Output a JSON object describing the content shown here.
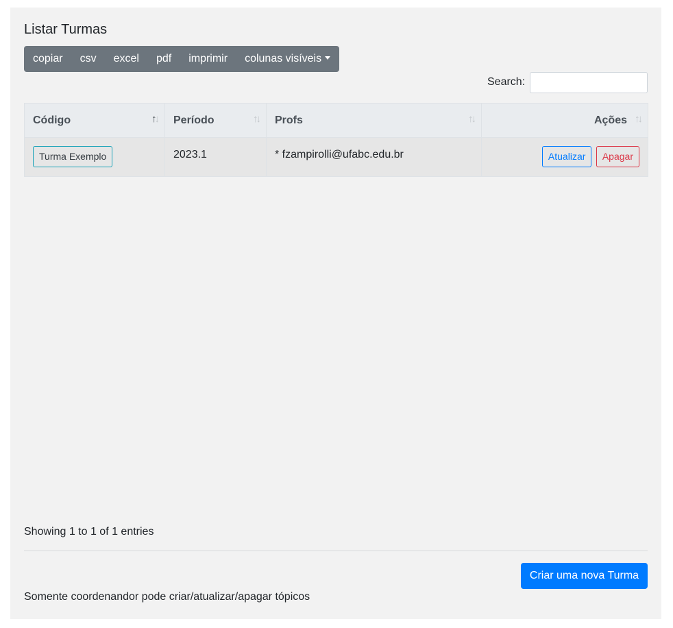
{
  "title": "Listar Turmas",
  "toolbar": {
    "buttons": [
      "copiar",
      "csv",
      "excel",
      "pdf",
      "imprimir",
      "colunas visíveis"
    ]
  },
  "search": {
    "label": "Search:",
    "value": ""
  },
  "table": {
    "columns": [
      "Código",
      "Período",
      "Profs",
      "Ações"
    ],
    "sort": {
      "column": "Código",
      "direction": "ascending"
    },
    "rows": [
      {
        "code": "Turma Exemplo",
        "period": "2023.1",
        "profs": "* fzampirolli@ufabc.edu.br",
        "actions": [
          "Atualizar",
          "Apagar"
        ]
      }
    ]
  },
  "info": "Showing 1 to 1 of 1 entries",
  "create_button": "Criar uma nova Turma",
  "note": "Somente coordenandor pode criar/atualizar/apagar tópicos",
  "colors": {
    "toolbar": "#6c757d",
    "primary": "#007bff",
    "danger": "#dc3545",
    "info": "#17a2b8"
  }
}
